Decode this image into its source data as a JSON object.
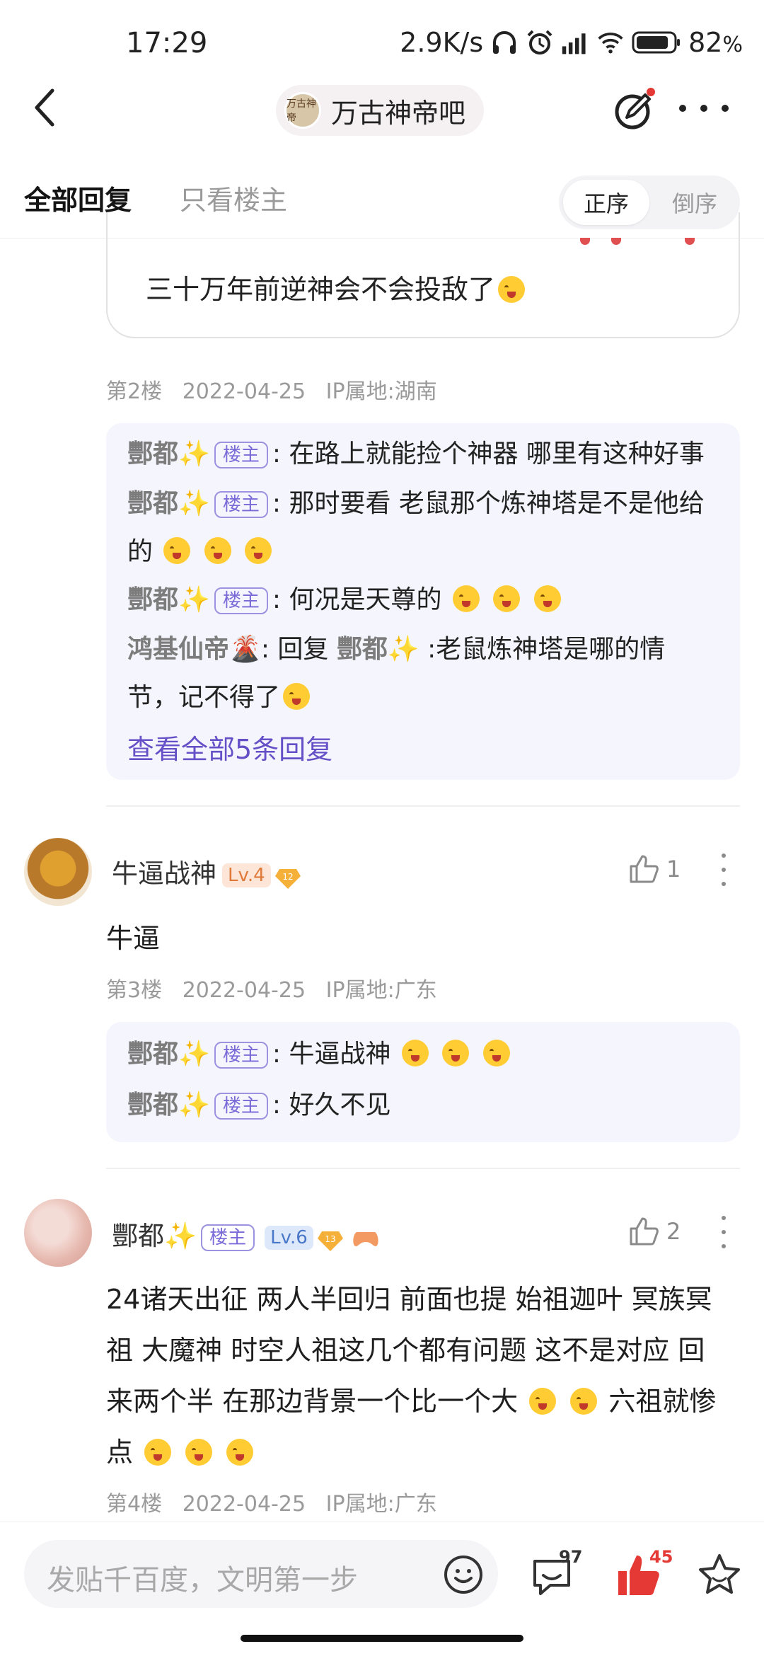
{
  "status_bar": {
    "time": "17:29",
    "net_speed": "2.9K/s",
    "battery": "82",
    "battery_unit": "%"
  },
  "header": {
    "forum_name": "万古神帝吧",
    "forum_avatar_text": "万古神帝"
  },
  "tabs": {
    "all": "全部回复",
    "owner_only": "只看楼主"
  },
  "sort": {
    "asc": "正序",
    "desc": "倒序"
  },
  "post2": {
    "quote_text": "三十万年前逆神会不会投敌了",
    "floor": "第2楼",
    "date": "2022-04-25",
    "ip": "IP属地:湖南",
    "replies": [
      {
        "user": "酆都✨",
        "badge": "楼主",
        "sep": ":",
        "text": "在路上就能捡个神器 哪里有这种好事"
      },
      {
        "user": "酆都✨",
        "badge": "楼主",
        "sep": ":",
        "text": "那时要看 老鼠那个炼神塔是不是他给",
        "text2": "的"
      },
      {
        "user": "酆都✨",
        "badge": "楼主",
        "sep": ":",
        "text": "何况是天尊的"
      },
      {
        "user": "鸿基仙帝🌋",
        "sep": ":",
        "prefix": "回复 ",
        "target": "酆都✨",
        "text": " :老鼠炼神塔是哪的情",
        "text2": "节，记不得了"
      }
    ],
    "more_link": "查看全部5条回复"
  },
  "post3": {
    "user": "牛逼战神",
    "level": "Lv.4",
    "diamond": "12",
    "likes": "1",
    "text": "牛逼",
    "floor": "第3楼",
    "date": "2022-04-25",
    "ip": "IP属地:广东",
    "replies": [
      {
        "user": "酆都✨",
        "badge": "楼主",
        "sep": ":",
        "text": "牛逼战神"
      },
      {
        "user": "酆都✨",
        "badge": "楼主",
        "sep": ":",
        "text": "好久不见"
      }
    ]
  },
  "post4": {
    "user": "酆都✨",
    "badge": "楼主",
    "level": "Lv.6",
    "diamond": "13",
    "likes": "2",
    "line1": "24诸天出征 两人半回归 前面也提 始祖迦叶 冥族冥",
    "line2": "祖 大魔神 时空人祖这几个都有问题 这不是对应 回",
    "line3": "来两个半 在那边背景一个比一个大",
    "line3b": "六祖就惨",
    "line4": "点",
    "floor": "第4楼",
    "date": "2022-04-25",
    "ip": "IP属地:广东"
  },
  "bottom": {
    "placeholder": "发贴千百度，文明第一步",
    "comment_count": "97",
    "like_count": "45"
  },
  "colors": {
    "accent_purple": "#6650c8",
    "like_red": "#e53935",
    "badge_purple": "#7a6ad8"
  }
}
